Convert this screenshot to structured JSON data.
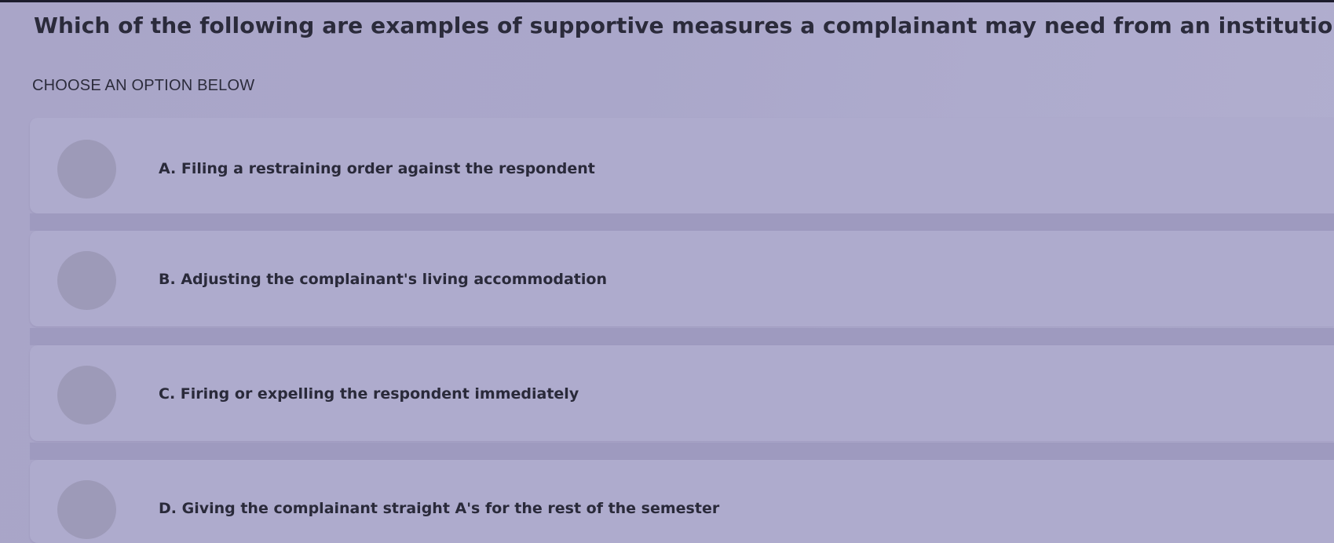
{
  "question": {
    "title": "Which of the following are examples of supportive measures a complainant may need from an institution?",
    "prompt": "CHOOSE AN OPTION BELOW"
  },
  "options": [
    {
      "label": "A. Filing a restraining order against the respondent"
    },
    {
      "label": "B. Adjusting the complainant's living accommodation"
    },
    {
      "label": "C. Firing or expelling the respondent immediately"
    },
    {
      "label": "D. Giving the complainant straight A's for the rest of the semester"
    }
  ]
}
